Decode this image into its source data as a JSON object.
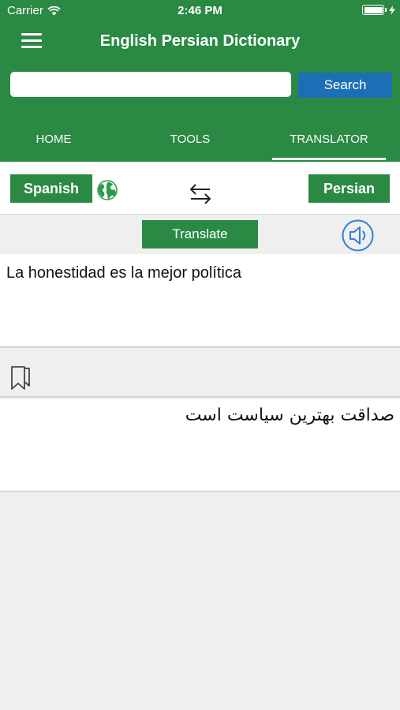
{
  "status_bar": {
    "carrier": "Carrier",
    "time": "2:46 PM"
  },
  "header": {
    "title": "English Persian Dictionary"
  },
  "search": {
    "placeholder": "",
    "value": "",
    "button_label": "Search"
  },
  "tabs": [
    {
      "label": "HOME",
      "active": false
    },
    {
      "label": "TOOLS",
      "active": false
    },
    {
      "label": "TRANSLATOR",
      "active": true
    }
  ],
  "translator": {
    "source_language": "Spanish",
    "target_language": "Persian",
    "translate_label": "Translate",
    "source_text": "La honestidad es la mejor política",
    "translated_text": "صداقت بهترین سیاست است"
  },
  "icons": {
    "menu": "menu-icon",
    "wifi": "wifi-icon",
    "battery": "battery-icon",
    "globe": "globe-icon",
    "swap": "swap-arrows-icon",
    "speaker": "speaker-icon",
    "bookmark": "bookmark-icon"
  },
  "colors": {
    "primary_green": "#2a8a43",
    "search_blue": "#1c6fb4",
    "speaker_blue": "#2f7fd6",
    "background": "#efefef"
  }
}
